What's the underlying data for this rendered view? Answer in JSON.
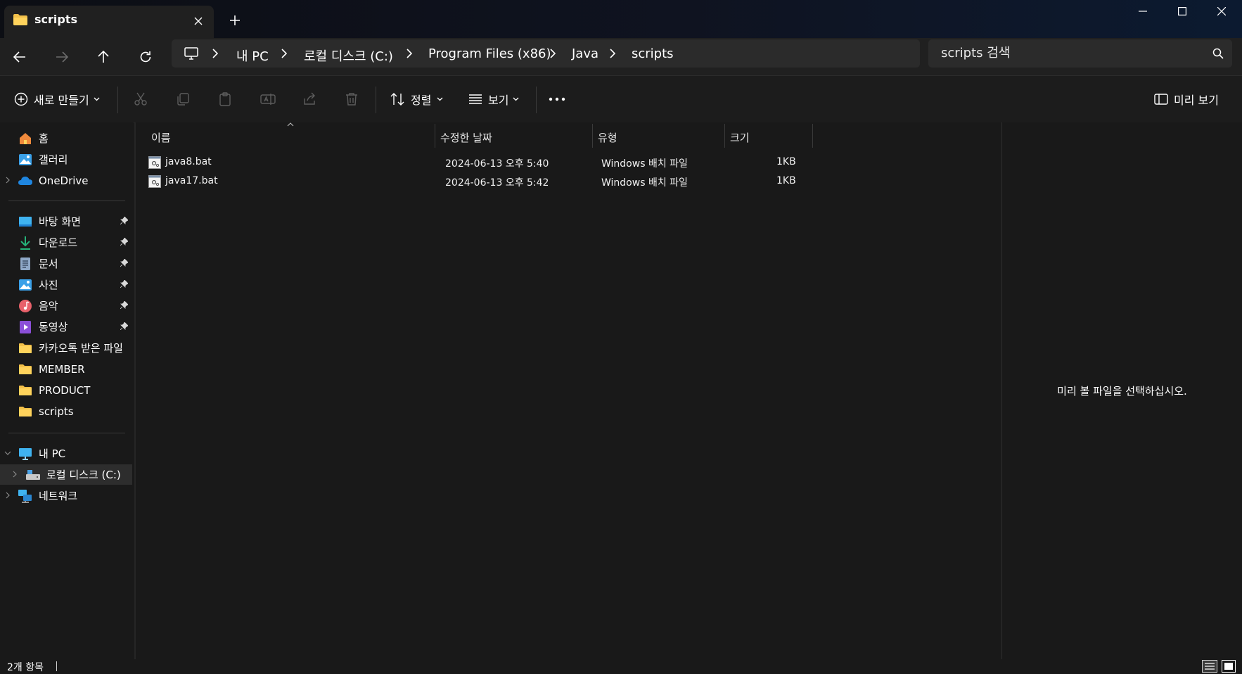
{
  "window": {
    "tab_title": "scripts",
    "tab_icon": "folder-icon",
    "accent": "#f7c948"
  },
  "breadcrumbs": [
    "내 PC",
    "로컬 디스크 (C:)",
    "Program Files (x86)",
    "Java",
    "scripts"
  ],
  "search": {
    "placeholder": "scripts 검색"
  },
  "commandbar": {
    "new_label": "새로 만들기",
    "sort_label": "정렬",
    "view_label": "보기",
    "preview_label": "미리 보기"
  },
  "sidebar": {
    "quick": [
      {
        "label": "홈",
        "icon": "home-icon"
      },
      {
        "label": "갤러리",
        "icon": "gallery-icon"
      },
      {
        "label": "OneDrive",
        "icon": "onedrive-icon"
      }
    ],
    "pinned": [
      {
        "label": "바탕 화면",
        "icon": "desktop-icon"
      },
      {
        "label": "다운로드",
        "icon": "download-icon"
      },
      {
        "label": "문서",
        "icon": "documents-icon"
      },
      {
        "label": "사진",
        "icon": "pictures-icon"
      },
      {
        "label": "음악",
        "icon": "music-icon"
      },
      {
        "label": "동영상",
        "icon": "videos-icon"
      }
    ],
    "folders": [
      {
        "label": "카카오톡 받은 파일"
      },
      {
        "label": "MEMBER"
      },
      {
        "label": "PRODUCT"
      },
      {
        "label": "scripts"
      }
    ],
    "devices": [
      {
        "label": "내 PC",
        "icon": "this-pc-icon"
      },
      {
        "label": "로컬 디스크 (C:)",
        "icon": "drive-icon"
      },
      {
        "label": "네트워크",
        "icon": "network-icon"
      }
    ]
  },
  "filelist": {
    "columns": [
      "이름",
      "수정한 날짜",
      "유형",
      "크기"
    ],
    "rows": [
      {
        "name": "java8.bat",
        "modified": "2024-06-13 오후 5:40",
        "type": "Windows 배치 파일",
        "size": "1KB"
      },
      {
        "name": "java17.bat",
        "modified": "2024-06-13 오후 5:42",
        "type": "Windows 배치 파일",
        "size": "1KB"
      }
    ]
  },
  "preview": {
    "message": "미리 볼 파일을 선택하십시오."
  },
  "status": {
    "item_count": "2개 항목"
  }
}
